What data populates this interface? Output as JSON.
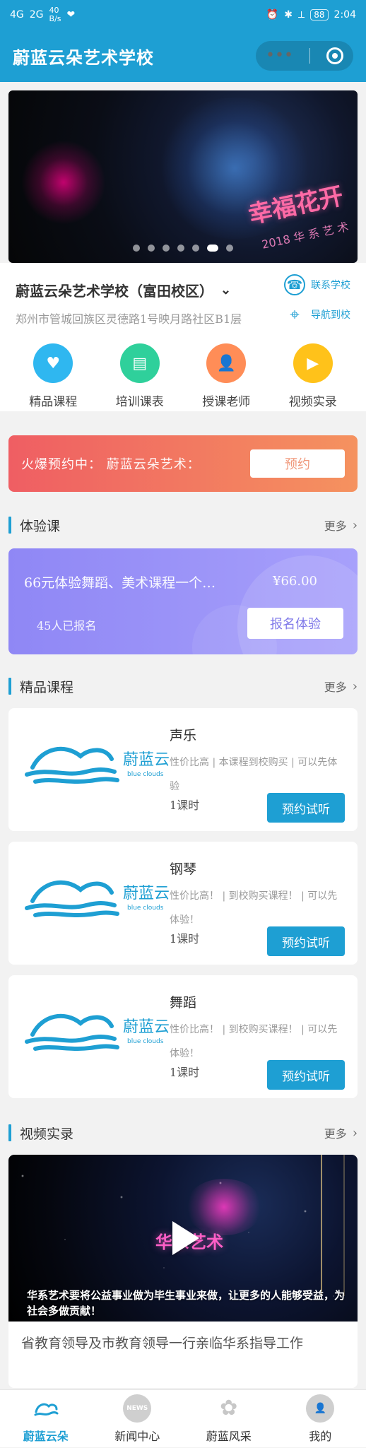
{
  "status_bar": {
    "network_left": "4G",
    "network_left2": "2G",
    "speed": "40\nB/s",
    "time": "2:04",
    "battery": "88"
  },
  "header": {
    "title": "蔚蓝云朵艺术学校",
    "capsule_more": "•••"
  },
  "school": {
    "name": "蔚蓝云朵艺术学校（富田校区）",
    "address": "郑州市管城回族区灵德路1号映月路社区B1层",
    "contact_label": "联系学校",
    "navigate_label": "导航到校"
  },
  "quick_links": [
    {
      "label": "精品课程",
      "icon": "heart-chat-icon",
      "color": "#2fb7f0"
    },
    {
      "label": "培训课表",
      "icon": "book-icon",
      "color": "#2fd09b"
    },
    {
      "label": "授课老师",
      "icon": "teacher-icon",
      "color": "#ff8d57"
    },
    {
      "label": "视频实录",
      "icon": "video-icon",
      "color": "#ffc21a"
    }
  ],
  "promo": {
    "text": "火爆预约中： 蔚蓝云朵艺术：",
    "button": "预约"
  },
  "sections": {
    "trial": {
      "title": "体验课",
      "more": "更多"
    },
    "courses": {
      "title": "精品课程",
      "more": "更多"
    },
    "videos": {
      "title": "视频实录",
      "more": "更多"
    }
  },
  "trial_card": {
    "title": "66元体验舞蹈、美术课程一个…",
    "price": "¥66.00",
    "signed": "45人已报名",
    "button": "报名体验"
  },
  "courses": [
    {
      "name": "声乐",
      "desc": "性价比高 | 本课程到校购买 | 可以先体验",
      "hours": "1课时",
      "button": "预约试听"
    },
    {
      "name": "钢琴",
      "desc": "性价比高！ | 到校购买课程！ | 可以先体验！",
      "hours": "1课时",
      "button": "预约试听"
    },
    {
      "name": "舞蹈",
      "desc": "性价比高！ | 到校购买课程！ | 可以先体验！",
      "hours": "1课时",
      "button": "预约试听"
    }
  ],
  "video": {
    "logo_text": "华系艺术",
    "subtitle": "华系艺术要将公益事业做为毕生事业来做，让更多的人能够受益，为社会多做贡献！",
    "caption": "省教育领导及市教育领导一行亲临华系指导工作"
  },
  "tabbar": [
    {
      "label": "蔚蓝云朵",
      "icon": "cloud-home-icon",
      "active": true
    },
    {
      "label": "新闻中心",
      "icon": "news-icon",
      "active": false,
      "icon_text": "NEWS"
    },
    {
      "label": "蔚蓝风采",
      "icon": "flower-icon",
      "active": false
    },
    {
      "label": "我的",
      "icon": "user-icon",
      "active": false
    }
  ],
  "colors": {
    "primary": "#1e9fd3",
    "promo_start": "#ef5e63",
    "promo_end": "#f5925f",
    "trial_start": "#8f87f5",
    "trial_end": "#a7a0fb"
  }
}
